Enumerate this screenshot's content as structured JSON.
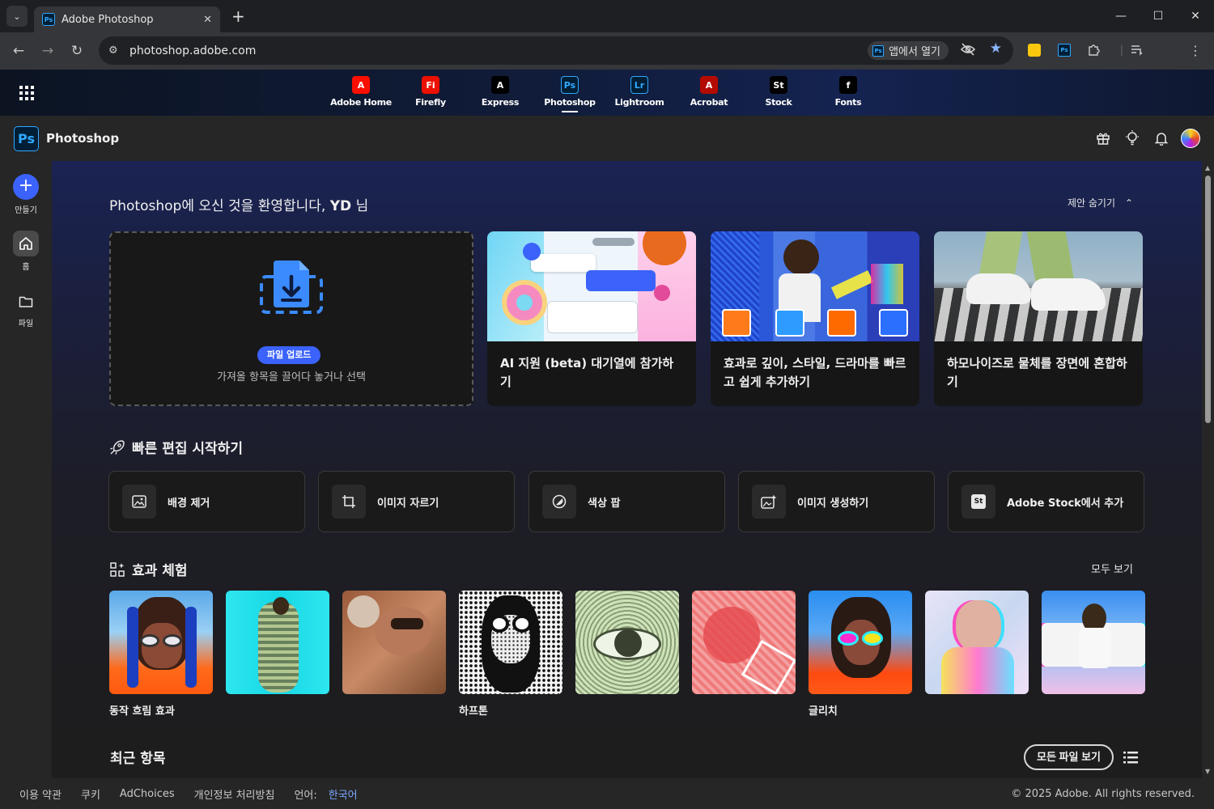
{
  "browser": {
    "tab_title": "Adobe Photoshop",
    "tab_favicon": "Ps",
    "url": "photoshop.adobe.com",
    "open_in_app": "앱에서 열기"
  },
  "app_switcher": [
    {
      "label": "Adobe Home",
      "code": "A",
      "color": "#fa0f00"
    },
    {
      "label": "Firefly",
      "code": "Fi",
      "color": "#eb1000"
    },
    {
      "label": "Express",
      "code": "A",
      "color": "#000000"
    },
    {
      "label": "Photoshop",
      "code": "Ps",
      "color": "#001e36"
    },
    {
      "label": "Lightroom",
      "code": "Lr",
      "color": "#001e36"
    },
    {
      "label": "Acrobat",
      "code": "A",
      "color": "#b30b00"
    },
    {
      "label": "Stock",
      "code": "St",
      "color": "#000000"
    },
    {
      "label": "Fonts",
      "code": "f",
      "color": "#000000"
    }
  ],
  "header": {
    "logo": "Ps",
    "app_name": "Photoshop"
  },
  "rail": {
    "create": "만들기",
    "home": "홈",
    "files": "파일"
  },
  "main": {
    "welcome_prefix": "Photoshop에 오신 것을 환영합니다, ",
    "welcome_name": "YD",
    "welcome_suffix": " 님",
    "hide_suggestions": "제안 숨기기",
    "upload_button": "파일 업로드",
    "upload_hint": "가져올 항목을 끌어다 놓거나 선택",
    "cards": [
      {
        "text": "AI 지원 (beta) 대기열에 참가하기"
      },
      {
        "text": "효과로 깊이, 스타일, 드라마를 빠르고 쉽게 추가하기"
      },
      {
        "text": "하모나이즈로 물체를 장면에 혼합하기"
      }
    ],
    "quick_title": "빠른 편집 시작하기",
    "quick_actions": [
      {
        "label": "배경 제거"
      },
      {
        "label": "이미지 자르기"
      },
      {
        "label": "색상 팝"
      },
      {
        "label": "이미지 생성하기"
      },
      {
        "label": "Adobe Stock에서 추가"
      }
    ],
    "effects_title": "효과 체험",
    "see_all": "모두 보기",
    "effect_labels": [
      "동작 흐림 효과",
      "하프톤",
      "글리치"
    ],
    "recent_title": "최근 항목",
    "all_files": "모든 파일 보기"
  },
  "footer": {
    "terms": "이용 약관",
    "cookies": "쿠키",
    "adchoices": "AdChoices",
    "privacy": "개인정보 처리방침",
    "language_label": "언어:",
    "language_value": "한국어",
    "copyright": "© 2025 Adobe. All rights reserved."
  },
  "colors": {
    "accent": "#3b63fb",
    "ps_blue": "#31a8ff"
  }
}
